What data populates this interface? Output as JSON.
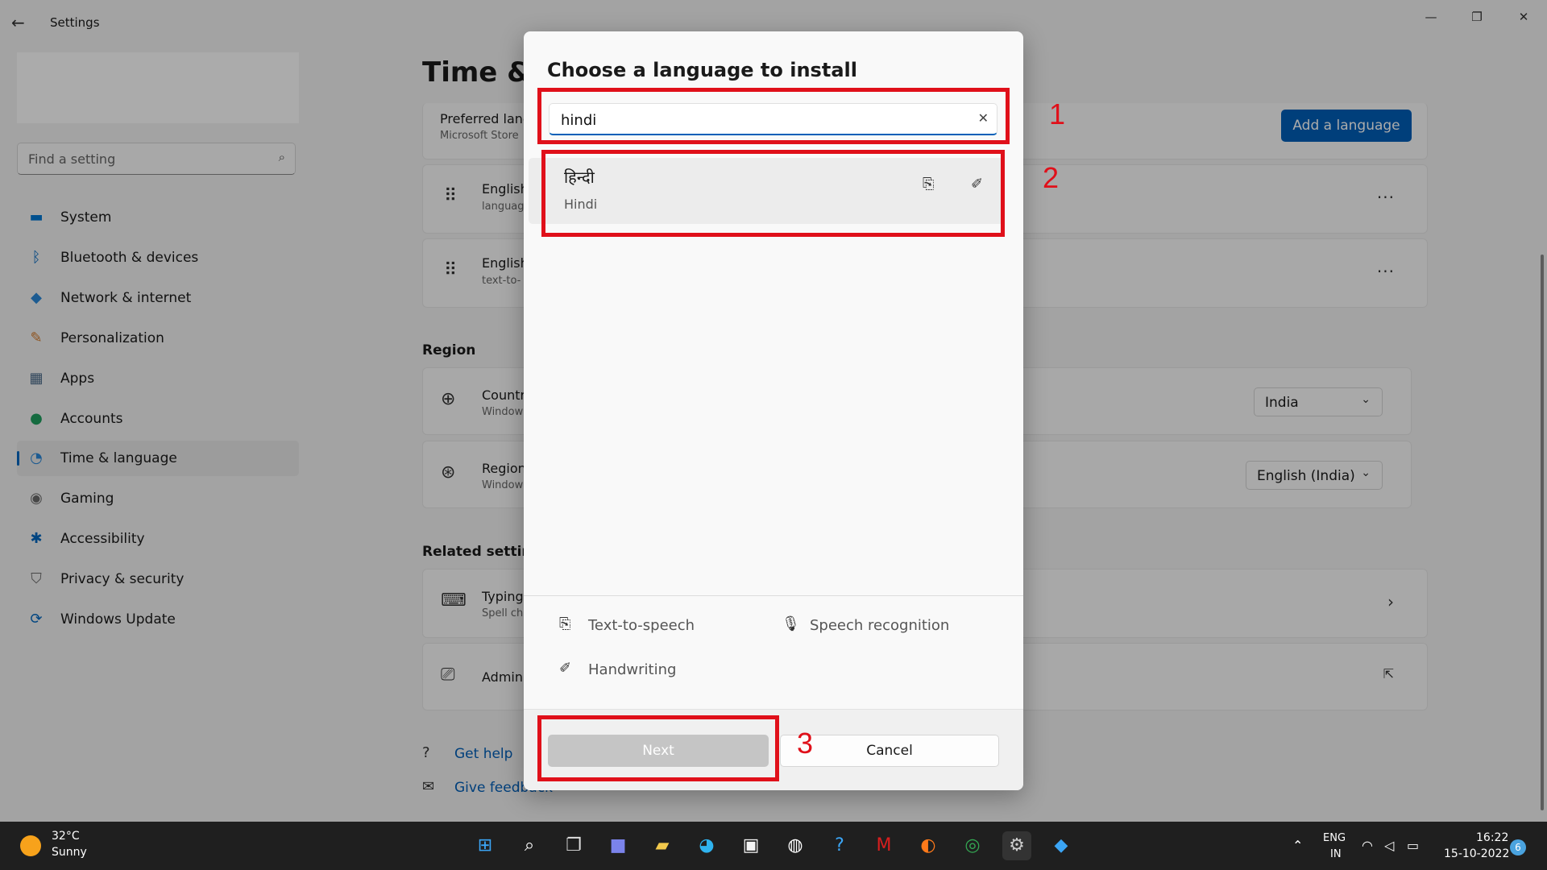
{
  "window": {
    "title": "Settings",
    "back_glyph": "←",
    "minimize_glyph": "—",
    "restore_glyph": "❐",
    "close_glyph": "✕"
  },
  "sidebar": {
    "search_placeholder": "Find a setting",
    "items": [
      {
        "label": "System",
        "icon": "monitor-icon",
        "color": "#0078d4"
      },
      {
        "label": "Bluetooth & devices",
        "icon": "bluetooth-icon",
        "color": "#0067c0"
      },
      {
        "label": "Network & internet",
        "icon": "wifi-icon",
        "color": "#2b88d8"
      },
      {
        "label": "Personalization",
        "icon": "brush-icon",
        "color": "#d47b2c"
      },
      {
        "label": "Apps",
        "icon": "apps-icon",
        "color": "#4a6a8a"
      },
      {
        "label": "Accounts",
        "icon": "person-icon",
        "color": "#20a060"
      },
      {
        "label": "Time & language",
        "icon": "globe-clock-icon",
        "color": "#2b88d8",
        "selected": true
      },
      {
        "label": "Gaming",
        "icon": "gamepad-icon",
        "color": "#6b6b6b"
      },
      {
        "label": "Accessibility",
        "icon": "accessibility-icon",
        "color": "#0067c0"
      },
      {
        "label": "Privacy & security",
        "icon": "shield-icon",
        "color": "#6b6b6b"
      },
      {
        "label": "Windows Update",
        "icon": "update-icon",
        "color": "#0067c0"
      }
    ]
  },
  "main": {
    "page_title": "Time & l",
    "preferred": {
      "title": "Preferred lang",
      "subtitle": "Microsoft Store",
      "add_button": "Add a language"
    },
    "languages": [
      {
        "title": "English",
        "subtitle": "languag"
      },
      {
        "title": "English",
        "subtitle": "text-to-"
      }
    ],
    "more_glyph": "···",
    "region_heading": "Region",
    "country": {
      "title": "Countr",
      "subtitle": "Window",
      "value": "India"
    },
    "regional_format": {
      "title": "Region",
      "subtitle": "Window",
      "value": "English (India)"
    },
    "related_heading": "Related settings",
    "typing": {
      "title": "Typing",
      "subtitle": "Spell ch"
    },
    "admin": {
      "title": "Admin"
    },
    "get_help": "Get help",
    "give_feedback": "Give feedback"
  },
  "dialog": {
    "title": "Choose a language to install",
    "search_value": "hindi",
    "clear_glyph": "✕",
    "result": {
      "native": "हिन्दी",
      "name": "Hindi"
    },
    "features": {
      "tts": "Text-to-speech",
      "speech": "Speech recognition",
      "handwriting": "Handwriting"
    },
    "next_label": "Next",
    "cancel_label": "Cancel"
  },
  "annotations": {
    "one": "1",
    "two": "2",
    "three": "3"
  },
  "taskbar": {
    "temperature": "32°C",
    "condition": "Sunny",
    "lang_line1": "ENG",
    "lang_line2": "IN",
    "time": "16:22",
    "date": "15-10-2022",
    "notification_count": "6"
  }
}
